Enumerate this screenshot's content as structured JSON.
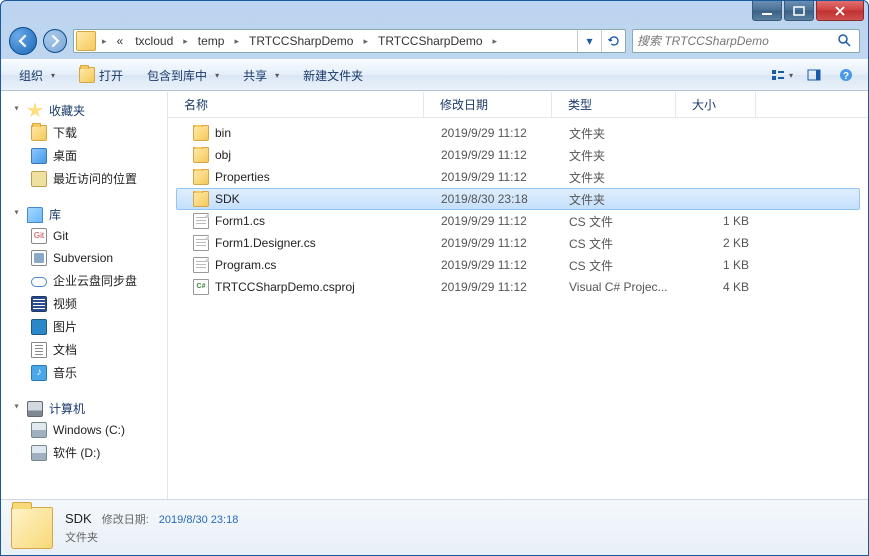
{
  "titlebar": {},
  "breadcrumb": {
    "prefix": "«",
    "segments": [
      "txcloud",
      "temp",
      "TRTCCSharpDemo",
      "TRTCCSharpDemo"
    ]
  },
  "search": {
    "placeholder": "搜索 TRTCCSharpDemo"
  },
  "toolbar": {
    "organize": "组织",
    "open": "打开",
    "include": "包含到库中",
    "share": "共享",
    "newfolder": "新建文件夹"
  },
  "sidebar": {
    "favorites": {
      "label": "收藏夹",
      "items": [
        {
          "label": "下载",
          "icon": "folder"
        },
        {
          "label": "桌面",
          "icon": "desktop"
        },
        {
          "label": "最近访问的位置",
          "icon": "recent"
        }
      ]
    },
    "libraries": {
      "label": "库",
      "items": [
        {
          "label": "Git",
          "icon": "git"
        },
        {
          "label": "Subversion",
          "icon": "svn"
        },
        {
          "label": "企业云盘同步盘",
          "icon": "cloud"
        },
        {
          "label": "视频",
          "icon": "video"
        },
        {
          "label": "图片",
          "icon": "pic"
        },
        {
          "label": "文档",
          "icon": "doc"
        },
        {
          "label": "音乐",
          "icon": "music"
        }
      ]
    },
    "computer": {
      "label": "计算机",
      "items": [
        {
          "label": "Windows (C:)",
          "icon": "drive"
        },
        {
          "label": "软件 (D:)",
          "icon": "drive"
        }
      ]
    }
  },
  "columns": {
    "name": "名称",
    "date": "修改日期",
    "type": "类型",
    "size": "大小"
  },
  "files": [
    {
      "name": "bin",
      "date": "2019/9/29 11:12",
      "type": "文件夹",
      "size": "",
      "icon": "folder",
      "selected": false
    },
    {
      "name": "obj",
      "date": "2019/9/29 11:12",
      "type": "文件夹",
      "size": "",
      "icon": "folder",
      "selected": false
    },
    {
      "name": "Properties",
      "date": "2019/9/29 11:12",
      "type": "文件夹",
      "size": "",
      "icon": "folder",
      "selected": false
    },
    {
      "name": "SDK",
      "date": "2019/8/30 23:18",
      "type": "文件夹",
      "size": "",
      "icon": "folder",
      "selected": true
    },
    {
      "name": "Form1.cs",
      "date": "2019/9/29 11:12",
      "type": "CS 文件",
      "size": "1 KB",
      "icon": "file",
      "selected": false
    },
    {
      "name": "Form1.Designer.cs",
      "date": "2019/9/29 11:12",
      "type": "CS 文件",
      "size": "2 KB",
      "icon": "file",
      "selected": false
    },
    {
      "name": "Program.cs",
      "date": "2019/9/29 11:12",
      "type": "CS 文件",
      "size": "1 KB",
      "icon": "file",
      "selected": false
    },
    {
      "name": "TRTCCSharpDemo.csproj",
      "date": "2019/9/29 11:12",
      "type": "Visual C# Projec...",
      "size": "4 KB",
      "icon": "csproj",
      "selected": false
    }
  ],
  "details": {
    "name": "SDK",
    "type": "文件夹",
    "date_label": "修改日期:",
    "date_value": "2019/8/30 23:18"
  }
}
